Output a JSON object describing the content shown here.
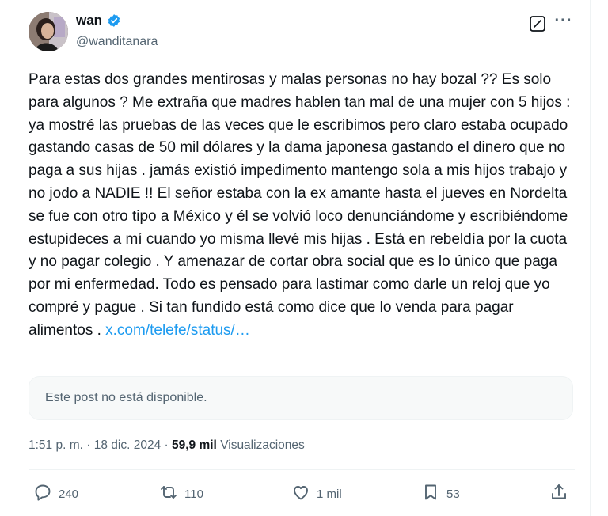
{
  "author": {
    "name": "wan",
    "handle": "@wanditanara",
    "verified": true
  },
  "post": {
    "text": "Para estas dos grandes mentirosas y malas personas no hay bozal ?? Es solo para algunos ? Me extraña que madres hablen tan mal de una mujer con 5 hijos : ya mostré las pruebas de las veces que le escribimos pero claro estaba ocupado gastando casas de 50 mil dólares y la dama japonesa gastando el dinero que no paga a sus hijas .  jamás existió impedimento mantengo sola a mis hijos trabajo y no jodo a NADIE !! El señor estaba con la ex amante hasta el jueves en Nordelta se fue con otro tipo a México y él se volvió loco denunciándome y escribiéndome estupideces a mí cuando yo misma llevé mis hijas .  Está en rebeldía por la cuota y no pagar colegio . Y amenazar de cortar obra social que es lo único que paga por mi enfermedad. Todo es pensado para lastimar como darle un reloj que yo compré y pague . Si tan fundido está como dice que lo venda para pagar alimentos .",
    "link": "x.com/telefe/status/…",
    "quote_unavailable": "Este post no está disponible.",
    "time": "1:51 p. m.",
    "separator": "·",
    "date": "18 dic. 2024",
    "views_count": "59,9 mil",
    "views_label": "Visualizaciones"
  },
  "actions": {
    "replies": "240",
    "reposts": "110",
    "likes": "1 mil",
    "bookmarks": "53"
  },
  "icons": {
    "verified": "verified-badge-icon",
    "grok": "grok-icon",
    "more": "more-icon",
    "reply": "reply-icon",
    "repost": "repost-icon",
    "like": "heart-icon",
    "bookmark": "bookmark-icon",
    "share": "share-icon"
  },
  "colors": {
    "link": "#1d9bf0",
    "verified": "#1d9bf0",
    "text": "#0f1419",
    "secondary": "#536471"
  }
}
